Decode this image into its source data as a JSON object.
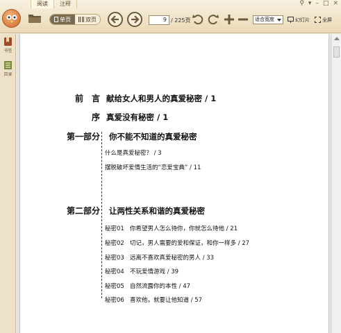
{
  "tabs": [
    "阅读",
    "注释"
  ],
  "window_controls": [
    "⚲",
    "▾",
    "–",
    "□",
    "×"
  ],
  "toolbar": {
    "single_page": "单页",
    "double_page": "双页",
    "current_page": "9",
    "total_pages": "/ 225页",
    "zoom_mode": "适合宽度",
    "slideshow": "幻灯片",
    "fullscreen": "全屏"
  },
  "sidebar": {
    "items": [
      {
        "label": "书签",
        "icon": "bookmark-icon"
      },
      {
        "label": "目录",
        "icon": "toc-icon"
      }
    ]
  },
  "toc": {
    "preface": {
      "label": "前　言",
      "title": "献给女人和男人的真爱秘密 / 1"
    },
    "foreword": {
      "label": "序",
      "title": "真爱没有秘密 / 1"
    },
    "part1": {
      "label": "第一部分",
      "title": "你不能不知道的真爱秘密",
      "items": [
        "什么是真爱秘密？ / 3",
        "摆脱破坏爱情生活的“恋爱宝典” / 11"
      ]
    },
    "part2": {
      "label": "第二部分",
      "title": "让两性关系和谐的真爱秘密",
      "items": [
        {
          "num": "秘密01",
          "text": "你希望男人怎么待你，你就怎么待他 / 21"
        },
        {
          "num": "秘密02",
          "text": "切记，男人需要的爱和保证，和你一样多 / 27"
        },
        {
          "num": "秘密03",
          "text": "远离不喜欢真爱秘密的男人 / 33"
        },
        {
          "num": "秘密04",
          "text": "不玩爱情游戏 / 39"
        },
        {
          "num": "秘密05",
          "text": "自然流露你的本性 / 47"
        },
        {
          "num": "秘密06",
          "text": "喜欢他，就要让他知道 / 57"
        }
      ]
    }
  }
}
